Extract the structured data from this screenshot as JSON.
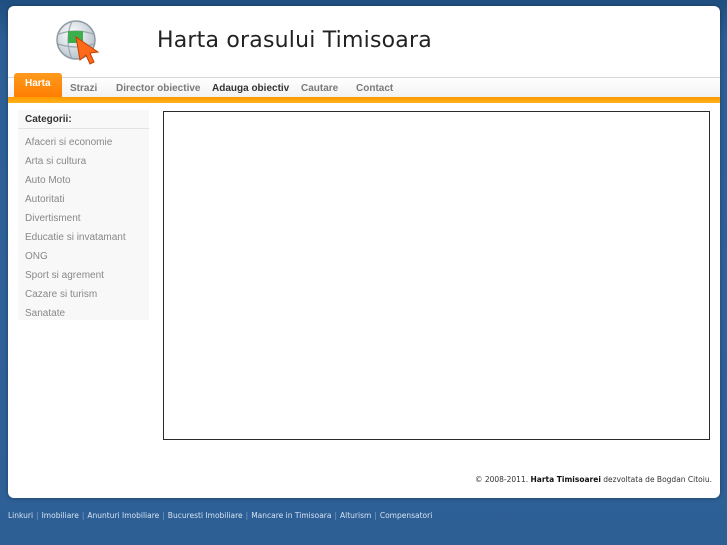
{
  "header": {
    "title": "Harta orasului Timisoara",
    "logo_icon": "globe-cursor-icon"
  },
  "nav": {
    "items": [
      {
        "label": "Harta"
      },
      {
        "label": "Strazi"
      },
      {
        "label": "Director obiective"
      },
      {
        "label": "Adauga obiectiv"
      },
      {
        "label": "Cautare"
      },
      {
        "label": "Contact"
      }
    ],
    "active_index": 0,
    "accent_color": "#ff8a00"
  },
  "sidebar": {
    "title": "Categorii:",
    "items": [
      {
        "label": "Afaceri si economie"
      },
      {
        "label": "Arta si cultura"
      },
      {
        "label": "Auto Moto"
      },
      {
        "label": "Autoritati"
      },
      {
        "label": "Divertisment"
      },
      {
        "label": "Educatie si invatamant"
      },
      {
        "label": "ONG"
      },
      {
        "label": "Sport si agrement"
      },
      {
        "label": "Cazare si turism"
      },
      {
        "label": "Sanatate"
      }
    ]
  },
  "footer": {
    "copyright_prefix": "© 2008-2011.",
    "copyright_brand": "Harta Timisoarei",
    "copyright_suffix": "dezvoltata de Bogdan Citoiu.",
    "links": [
      {
        "label": "Linkuri"
      },
      {
        "label": "Imobiliare"
      },
      {
        "label": "Anunturi Imobiliare"
      },
      {
        "label": "Bucuresti Imobiliare"
      },
      {
        "label": "Mancare in Timisoara"
      },
      {
        "label": "Alturism"
      },
      {
        "label": "Compensatori"
      }
    ]
  }
}
